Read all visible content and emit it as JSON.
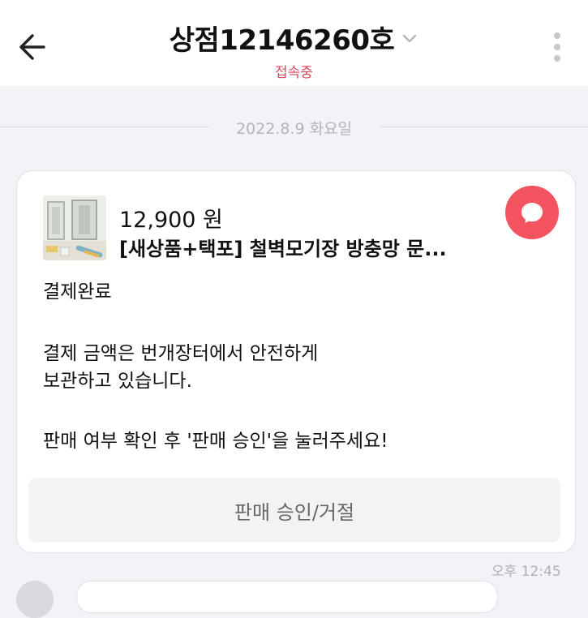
{
  "header": {
    "title": "상점12146260호",
    "status": "접속중",
    "back_icon": "back-arrow-icon",
    "dropdown_icon": "chevron-down-icon",
    "more_icon": "more-vertical-icon"
  },
  "date_divider": "2022.8.9 화요일",
  "card": {
    "price": "12,900 원",
    "product_name": "[새상품+택포] 철벽모기장 방충망 문...",
    "badge_icon": "chat-bubble-icon",
    "message_title": "결제완료",
    "message_line1": "결제 금액은 번개장터에서 안전하게",
    "message_line2": "보관하고 있습니다.",
    "message_line3": "판매 여부 확인 후 '판매 승인'을 눌러주세요!",
    "action_label": "판매 승인/거절"
  },
  "timestamp": "오후 12:45",
  "colors": {
    "accent_red": "#f4545f",
    "status_red": "#d9485a",
    "background": "#f2f2f7"
  }
}
